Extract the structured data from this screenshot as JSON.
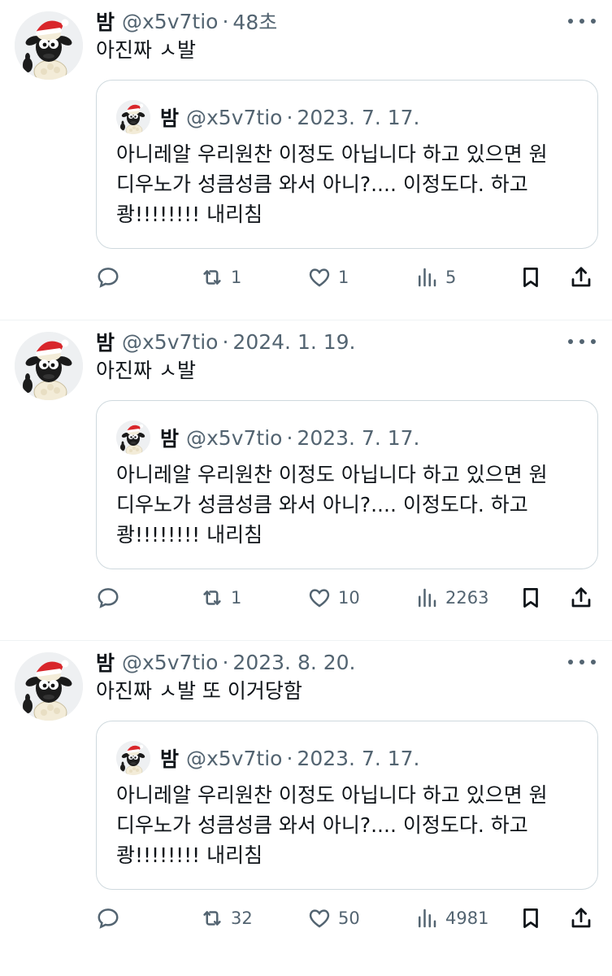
{
  "tweets": [
    {
      "name": "밤",
      "handle": "@x5v7tio",
      "time": "48초",
      "text": "아진짜 ㅅ발",
      "quote": {
        "name": "밤",
        "handle": "@x5v7tio",
        "time": "2023. 7. 17.",
        "lines": [
          "아니레알 우리원찬 이정도 아닙니다 하고 있으면 원",
          "디우노가 성큼성큼 와서 아니?.... 이정도다. 하고",
          "쾅!!!!!!!! 내리침"
        ]
      },
      "retweets": "1",
      "likes": "1",
      "views": "5"
    },
    {
      "name": "밤",
      "handle": "@x5v7tio",
      "time": "2024. 1. 19.",
      "text": "아진짜 ㅅ발",
      "quote": {
        "name": "밤",
        "handle": "@x5v7tio",
        "time": "2023. 7. 17.",
        "lines": [
          "아니레알 우리원찬 이정도 아닙니다 하고 있으면 원",
          "디우노가 성큼성큼 와서 아니?.... 이정도다. 하고",
          "쾅!!!!!!!! 내리침"
        ]
      },
      "retweets": "1",
      "likes": "10",
      "views": "2263"
    },
    {
      "name": "밤",
      "handle": "@x5v7tio",
      "time": "2023. 8. 20.",
      "text": "아진짜 ㅅ발 또 이거당함",
      "quote": {
        "name": "밤",
        "handle": "@x5v7tio",
        "time": "2023. 7. 17.",
        "lines": [
          "아니레알 우리원찬 이정도 아닙니다 하고 있으면 원",
          "디우노가 성큼성큼 와서 아니?.... 이정도다. 하고",
          "쾅!!!!!!!! 내리침"
        ]
      },
      "retweets": "32",
      "likes": "50",
      "views": "4981"
    }
  ],
  "separator": "·",
  "icons": {
    "avatar": "sheep-santa-hat-icon",
    "more": "more-dots-icon",
    "reply": "reply-icon",
    "retweet": "retweet-icon",
    "like": "heart-icon",
    "views": "views-bar-chart-icon",
    "bookmark": "bookmark-icon",
    "share": "share-icon"
  },
  "colors": {
    "text": "#0f1419",
    "secondary": "#536471",
    "border": "#cfd9de"
  }
}
